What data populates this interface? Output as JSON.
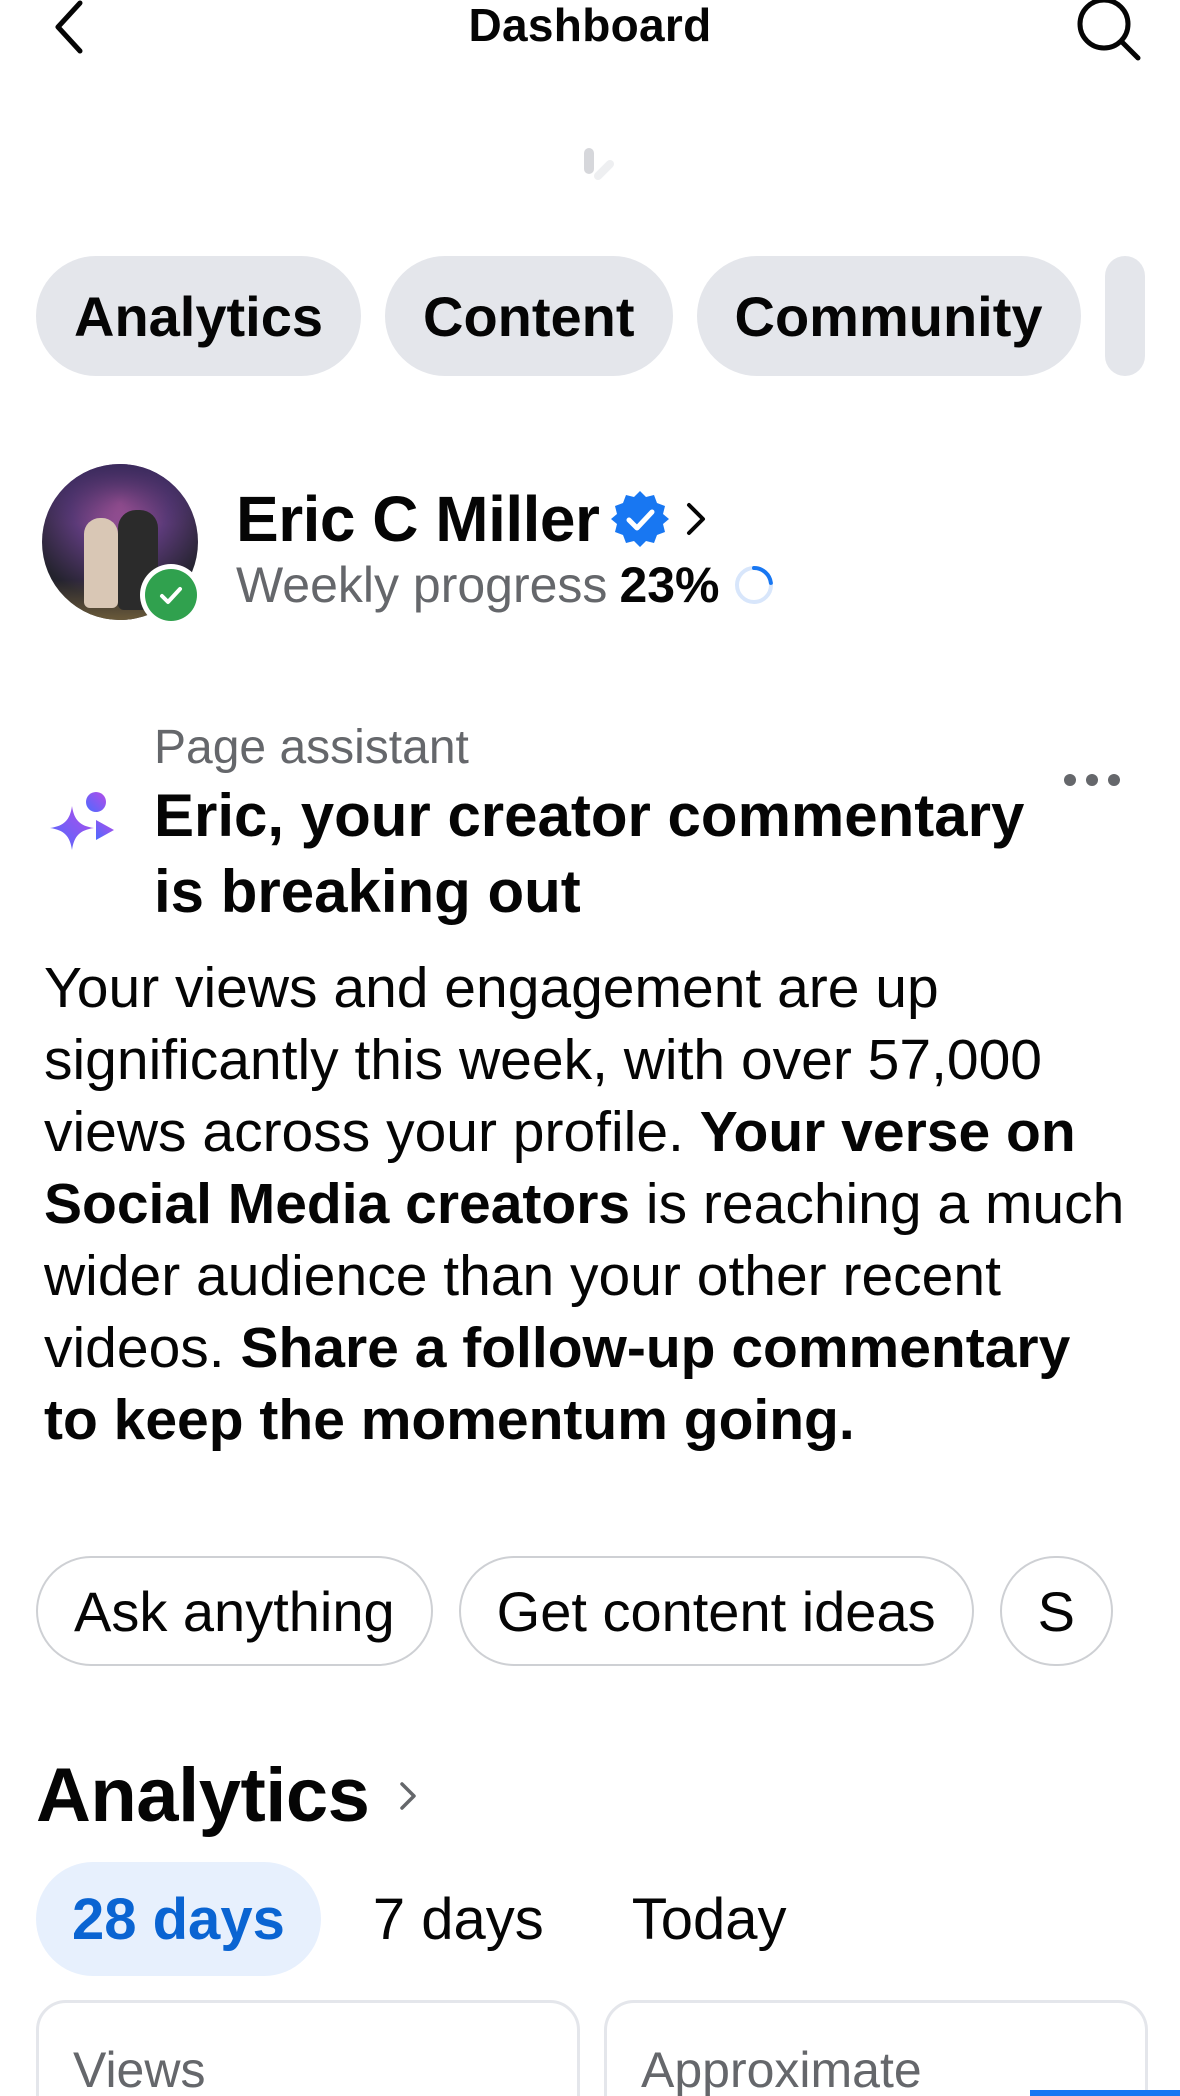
{
  "header": {
    "title": "Dashboard",
    "back_icon": "chevron-left-icon",
    "search_icon": "search-icon"
  },
  "tabs": [
    "Analytics",
    "Content",
    "Community"
  ],
  "profile": {
    "name": "Eric C Miller",
    "verified_icon": "verified-badge-icon",
    "progress_label": "Weekly progress",
    "progress_value": "23%",
    "progress_fraction": 0.23
  },
  "assistant": {
    "label": "Page assistant",
    "headline": "Eric, your creator commentary is breaking out",
    "body_1": "Your views and engagement are up significantly this week, with over 57,000 views across your profile. ",
    "body_2": "Your verse on Social Media creators",
    "body_3": " is reaching a much wider audience than your other recent videos. ",
    "body_4": "Share a follow-up commentary to keep the momentum going."
  },
  "suggestions": [
    "Ask anything",
    "Get content ideas",
    "S"
  ],
  "analytics": {
    "title": "Analytics",
    "ranges": [
      "28 days",
      "7 days",
      "Today"
    ],
    "active_range": "28 days",
    "cards": [
      "Views",
      "Approximate"
    ]
  },
  "colors": {
    "accent": "#1877f2",
    "chip_bg": "#e4e6eb",
    "active_tab_text": "#0a64d2",
    "active_tab_bg": "#e7f0fd",
    "online_green": "#30a14e"
  }
}
